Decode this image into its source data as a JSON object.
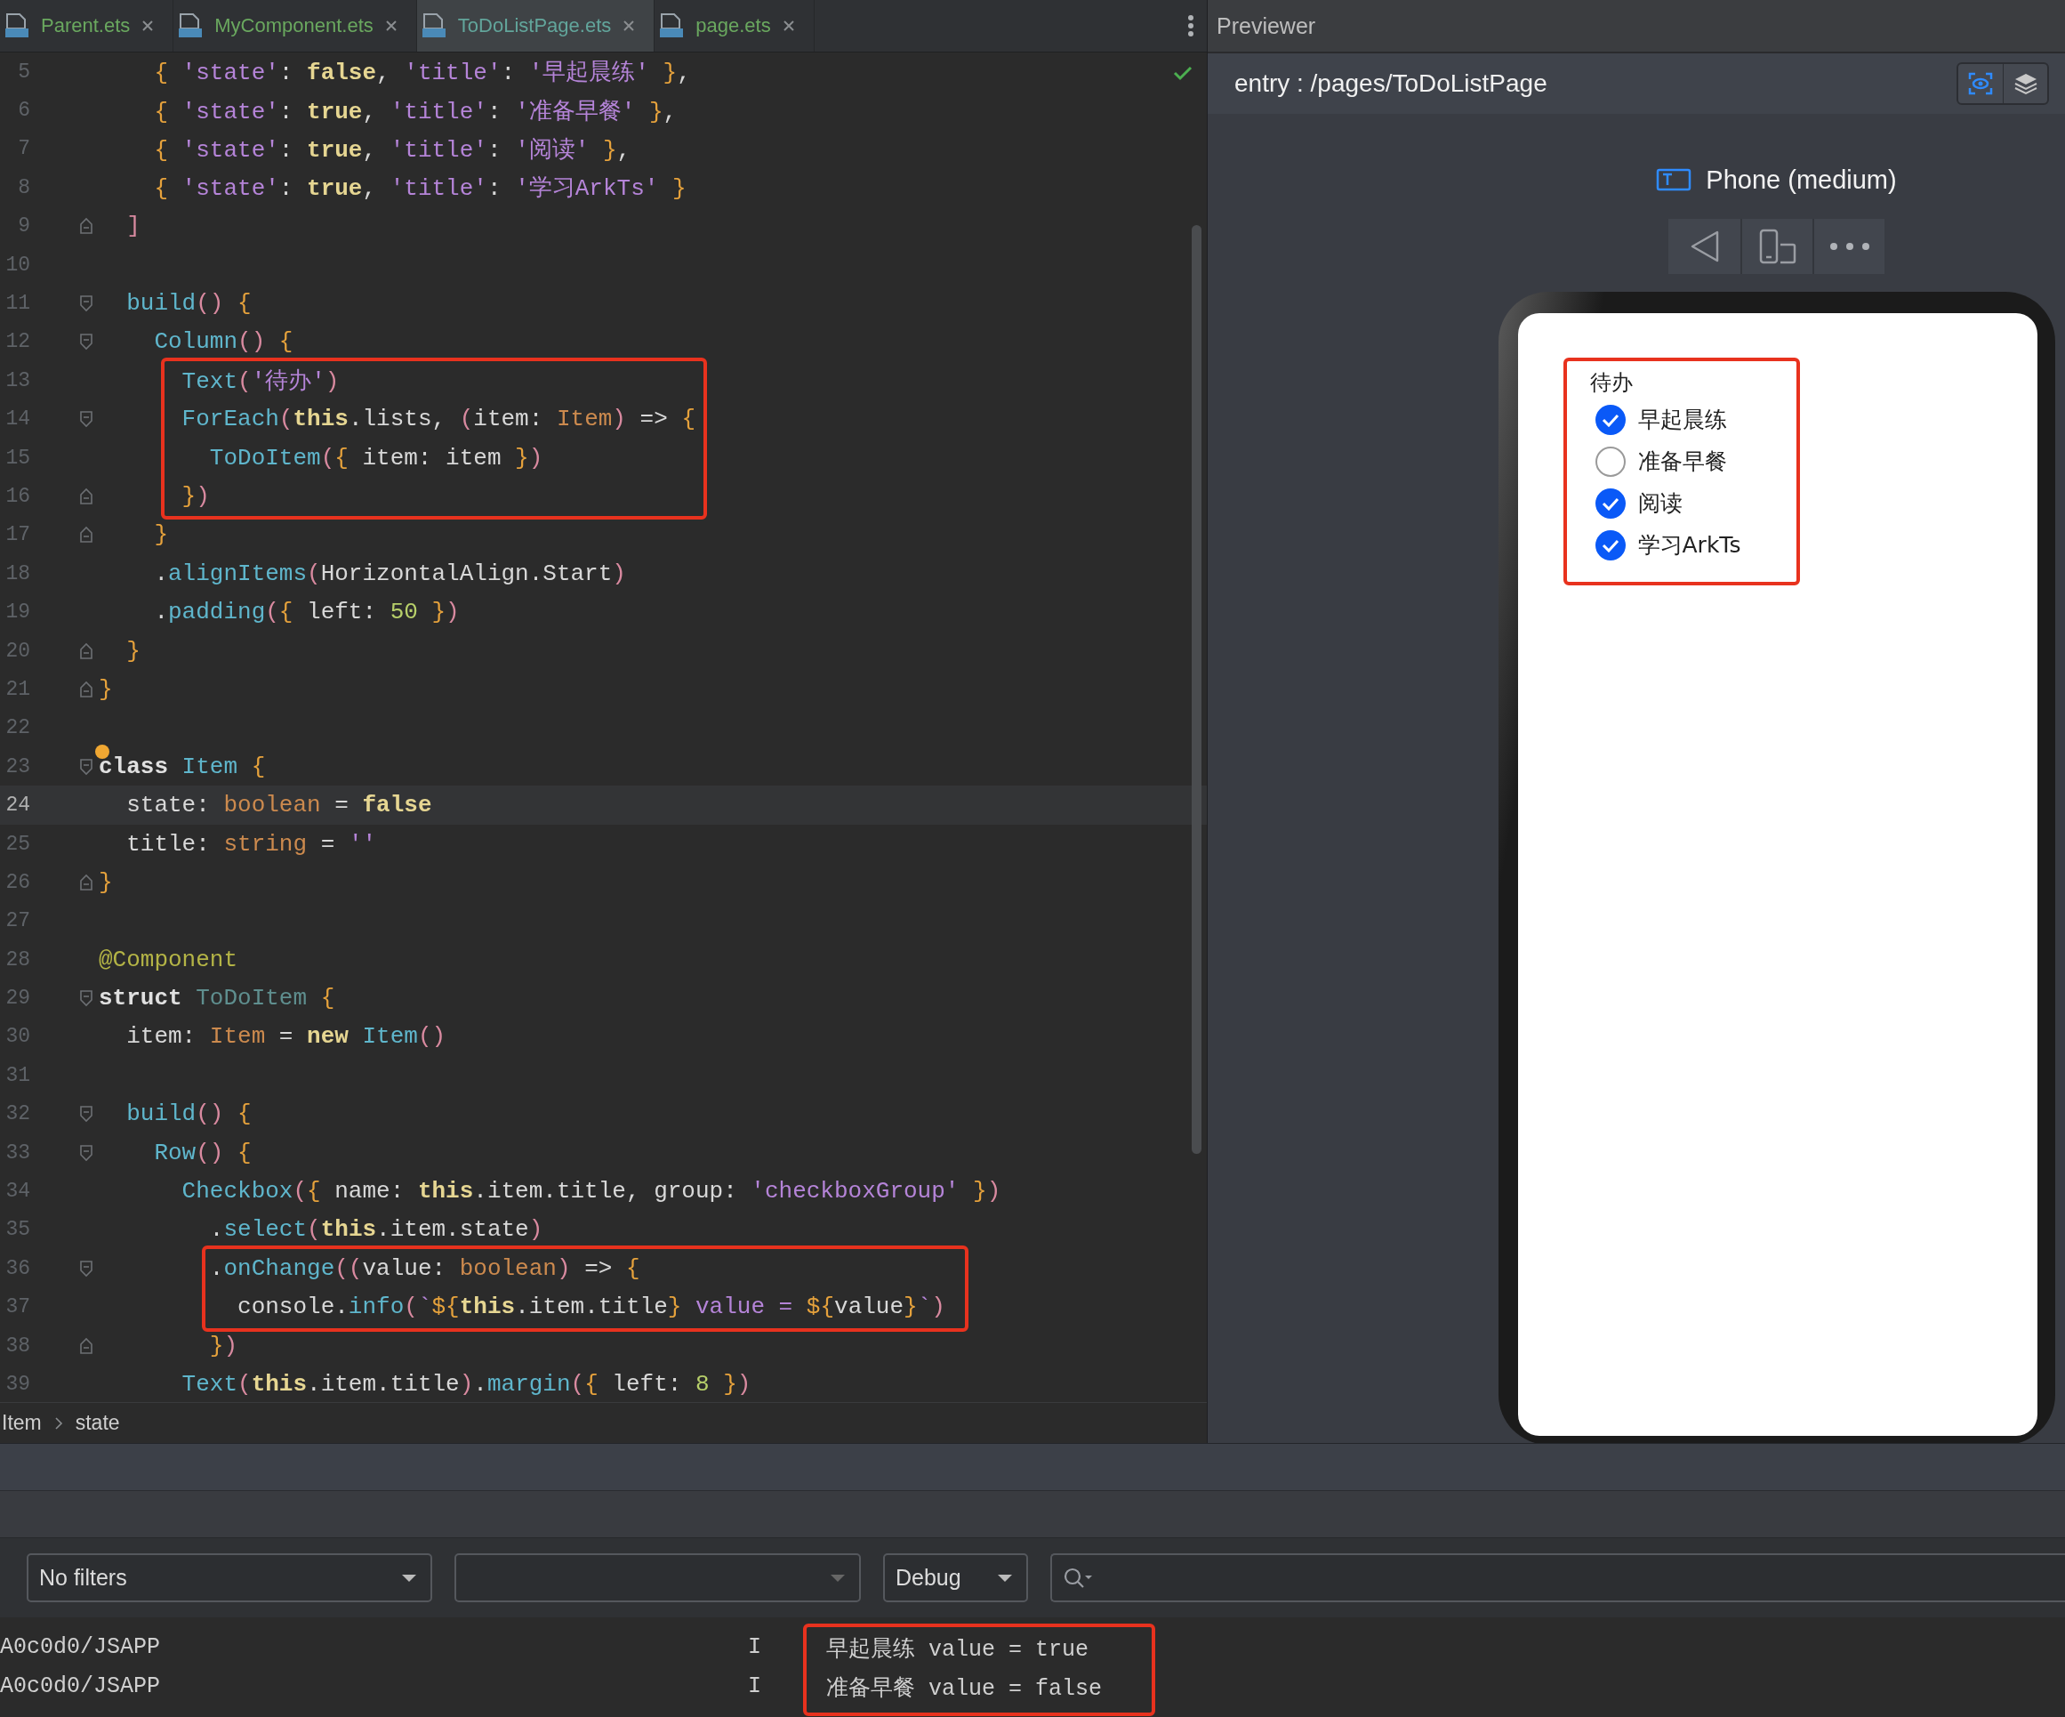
{
  "tabs": [
    {
      "label": "Parent.ets",
      "selected": false
    },
    {
      "label": "MyComponent.ets",
      "selected": false
    },
    {
      "label": "ToDoListPage.ets",
      "selected": true
    },
    {
      "label": "page.ets",
      "selected": false
    }
  ],
  "editor": {
    "lines": [
      {
        "number": "5",
        "tokens": [
          {
            "kind": "brace",
            "text": "    {"
          },
          {
            "kind": "string",
            "text": " 'state'"
          },
          {
            "kind": "plain",
            "text": ": "
          },
          {
            "kind": "keyword",
            "text": "false"
          },
          {
            "kind": "plain",
            "text": ", "
          },
          {
            "kind": "string",
            "text": "'title'"
          },
          {
            "kind": "plain",
            "text": ": "
          },
          {
            "kind": "string",
            "text": "'早起晨练'"
          },
          {
            "kind": "brace",
            "text": " }"
          },
          {
            "kind": "plain",
            "text": ","
          }
        ]
      },
      {
        "number": "6",
        "tokens": [
          {
            "kind": "brace",
            "text": "    {"
          },
          {
            "kind": "string",
            "text": " 'state'"
          },
          {
            "kind": "plain",
            "text": ": "
          },
          {
            "kind": "keyword",
            "text": "true"
          },
          {
            "kind": "plain",
            "text": ", "
          },
          {
            "kind": "string",
            "text": "'title'"
          },
          {
            "kind": "plain",
            "text": ": "
          },
          {
            "kind": "string",
            "text": "'准备早餐'"
          },
          {
            "kind": "brace",
            "text": " }"
          },
          {
            "kind": "plain",
            "text": ","
          }
        ]
      },
      {
        "number": "7",
        "tokens": [
          {
            "kind": "brace",
            "text": "    {"
          },
          {
            "kind": "string",
            "text": " 'state'"
          },
          {
            "kind": "plain",
            "text": ": "
          },
          {
            "kind": "keyword",
            "text": "true"
          },
          {
            "kind": "plain",
            "text": ", "
          },
          {
            "kind": "string",
            "text": "'title'"
          },
          {
            "kind": "plain",
            "text": ": "
          },
          {
            "kind": "string",
            "text": "'阅读'"
          },
          {
            "kind": "brace",
            "text": " }"
          },
          {
            "kind": "plain",
            "text": ","
          }
        ]
      },
      {
        "number": "8",
        "tokens": [
          {
            "kind": "brace",
            "text": "    {"
          },
          {
            "kind": "string",
            "text": " 'state'"
          },
          {
            "kind": "plain",
            "text": ": "
          },
          {
            "kind": "keyword",
            "text": "true"
          },
          {
            "kind": "plain",
            "text": ", "
          },
          {
            "kind": "string",
            "text": "'title'"
          },
          {
            "kind": "plain",
            "text": ": "
          },
          {
            "kind": "string",
            "text": "'学习ArkTs'"
          },
          {
            "kind": "brace",
            "text": " }"
          }
        ]
      },
      {
        "number": "9",
        "fold_close": true,
        "tokens": [
          {
            "kind": "paren",
            "text": "  ]"
          }
        ]
      },
      {
        "number": "10"
      },
      {
        "number": "11",
        "fold_open": true,
        "tokens": [
          {
            "kind": "func",
            "text": "  build"
          },
          {
            "kind": "paren",
            "text": "()"
          },
          {
            "kind": "brace",
            "text": " {"
          }
        ]
      },
      {
        "number": "12",
        "fold_open": true,
        "tokens": [
          {
            "kind": "func",
            "text": "    Column"
          },
          {
            "kind": "paren",
            "text": "()"
          },
          {
            "kind": "brace",
            "text": " {"
          }
        ]
      },
      {
        "number": "13",
        "tokens": [
          {
            "kind": "func",
            "text": "      Text"
          },
          {
            "kind": "paren",
            "text": "("
          },
          {
            "kind": "string",
            "text": "'待办'"
          },
          {
            "kind": "paren",
            "text": ")"
          }
        ]
      },
      {
        "number": "14",
        "fold_open": true,
        "tokens": [
          {
            "kind": "func",
            "text": "      ForEach"
          },
          {
            "kind": "paren",
            "text": "("
          },
          {
            "kind": "keyword",
            "text": "this"
          },
          {
            "kind": "plain",
            "text": ".lists, "
          },
          {
            "kind": "paren",
            "text": "("
          },
          {
            "kind": "plain",
            "text": "item: "
          },
          {
            "kind": "type",
            "text": "Item"
          },
          {
            "kind": "paren",
            "text": ")"
          },
          {
            "kind": "plain",
            "text": " => "
          },
          {
            "kind": "brace",
            "text": "{"
          }
        ]
      },
      {
        "number": "15",
        "tokens": [
          {
            "kind": "func",
            "text": "        ToDoItem"
          },
          {
            "kind": "paren",
            "text": "("
          },
          {
            "kind": "brace",
            "text": "{"
          },
          {
            "kind": "plain",
            "text": " item: item "
          },
          {
            "kind": "brace",
            "text": "}"
          },
          {
            "kind": "paren",
            "text": ")"
          }
        ]
      },
      {
        "number": "16",
        "fold_close": true,
        "tokens": [
          {
            "kind": "brace",
            "text": "      }"
          },
          {
            "kind": "paren",
            "text": ")"
          }
        ]
      },
      {
        "number": "17",
        "fold_close": true,
        "tokens": [
          {
            "kind": "brace",
            "text": "    }"
          }
        ]
      },
      {
        "number": "18",
        "tokens": [
          {
            "kind": "plain",
            "text": "    ."
          },
          {
            "kind": "func",
            "text": "alignItems"
          },
          {
            "kind": "paren",
            "text": "("
          },
          {
            "kind": "plain",
            "text": "HorizontalAlign.Start"
          },
          {
            "kind": "paren",
            "text": ")"
          }
        ]
      },
      {
        "number": "19",
        "tokens": [
          {
            "kind": "plain",
            "text": "    ."
          },
          {
            "kind": "func",
            "text": "padding"
          },
          {
            "kind": "paren",
            "text": "("
          },
          {
            "kind": "brace",
            "text": "{"
          },
          {
            "kind": "plain",
            "text": " left: "
          },
          {
            "kind": "number",
            "text": "50"
          },
          {
            "kind": "brace",
            "text": " }"
          },
          {
            "kind": "paren",
            "text": ")"
          }
        ]
      },
      {
        "number": "20",
        "fold_close": true,
        "tokens": [
          {
            "kind": "brace",
            "text": "  }"
          }
        ]
      },
      {
        "number": "21",
        "fold_close": true,
        "tokens": [
          {
            "kind": "brace",
            "text": "}"
          }
        ]
      },
      {
        "number": "22"
      },
      {
        "number": "23",
        "fold_open": true,
        "bulb": true,
        "tokens": [
          {
            "kind": "declare",
            "text": "class"
          },
          {
            "kind": "func",
            "text": " Item"
          },
          {
            "kind": "brace",
            "text": " {"
          }
        ]
      },
      {
        "number": "24",
        "current": true,
        "tokens": [
          {
            "kind": "plain",
            "text": "  state: "
          },
          {
            "kind": "type",
            "text": "boolean"
          },
          {
            "kind": "plain",
            "text": " = "
          },
          {
            "kind": "keyword",
            "text": "false"
          }
        ]
      },
      {
        "number": "25",
        "tokens": [
          {
            "kind": "plain",
            "text": "  title: "
          },
          {
            "kind": "type",
            "text": "string"
          },
          {
            "kind": "plain",
            "text": " = "
          },
          {
            "kind": "string",
            "text": "''"
          }
        ]
      },
      {
        "number": "26",
        "fold_close": true,
        "tokens": [
          {
            "kind": "brace",
            "text": "}"
          }
        ]
      },
      {
        "number": "27"
      },
      {
        "number": "28",
        "tokens": [
          {
            "kind": "annotation",
            "text": "@Component"
          }
        ]
      },
      {
        "number": "29",
        "fold_open": true,
        "tokens": [
          {
            "kind": "declare",
            "text": "struct"
          },
          {
            "kind": "unused",
            "text": " ToDoItem"
          },
          {
            "kind": "brace",
            "text": " {"
          }
        ]
      },
      {
        "number": "30",
        "tokens": [
          {
            "kind": "plain",
            "text": "  item: "
          },
          {
            "kind": "type",
            "text": "Item"
          },
          {
            "kind": "plain",
            "text": " = "
          },
          {
            "kind": "keyword",
            "text": "new"
          },
          {
            "kind": "func",
            "text": " Item"
          },
          {
            "kind": "paren",
            "text": "()"
          }
        ]
      },
      {
        "number": "31"
      },
      {
        "number": "32",
        "fold_open": true,
        "tokens": [
          {
            "kind": "func",
            "text": "  build"
          },
          {
            "kind": "paren",
            "text": "()"
          },
          {
            "kind": "brace",
            "text": " {"
          }
        ]
      },
      {
        "number": "33",
        "fold_open": true,
        "tokens": [
          {
            "kind": "func",
            "text": "    Row"
          },
          {
            "kind": "paren",
            "text": "()"
          },
          {
            "kind": "brace",
            "text": " {"
          }
        ]
      },
      {
        "number": "34",
        "tokens": [
          {
            "kind": "func",
            "text": "      Checkbox"
          },
          {
            "kind": "paren",
            "text": "("
          },
          {
            "kind": "brace",
            "text": "{"
          },
          {
            "kind": "plain",
            "text": " name: "
          },
          {
            "kind": "keyword",
            "text": "this"
          },
          {
            "kind": "plain",
            "text": ".item.title, group: "
          },
          {
            "kind": "string",
            "text": "'checkboxGroup'"
          },
          {
            "kind": "brace",
            "text": " }"
          },
          {
            "kind": "paren",
            "text": ")"
          }
        ]
      },
      {
        "number": "35",
        "tokens": [
          {
            "kind": "plain",
            "text": "        ."
          },
          {
            "kind": "func",
            "text": "select"
          },
          {
            "kind": "paren",
            "text": "("
          },
          {
            "kind": "keyword",
            "text": "this"
          },
          {
            "kind": "plain",
            "text": ".item.state"
          },
          {
            "kind": "paren",
            "text": ")"
          }
        ]
      },
      {
        "number": "36",
        "fold_open": true,
        "tokens": [
          {
            "kind": "plain",
            "text": "        ."
          },
          {
            "kind": "func",
            "text": "onChange"
          },
          {
            "kind": "paren",
            "text": "(("
          },
          {
            "kind": "plain",
            "text": "value: "
          },
          {
            "kind": "type",
            "text": "boolean"
          },
          {
            "kind": "paren",
            "text": ")"
          },
          {
            "kind": "plain",
            "text": " => "
          },
          {
            "kind": "brace",
            "text": "{"
          }
        ]
      },
      {
        "number": "37",
        "tokens": [
          {
            "kind": "plain",
            "text": "          console."
          },
          {
            "kind": "func",
            "text": "info"
          },
          {
            "kind": "paren",
            "text": "("
          },
          {
            "kind": "string",
            "text": "`"
          },
          {
            "kind": "brace",
            "text": "${"
          },
          {
            "kind": "keyword",
            "text": "this"
          },
          {
            "kind": "plain",
            "text": ".item.title"
          },
          {
            "kind": "brace",
            "text": "}"
          },
          {
            "kind": "string",
            "text": " value = "
          },
          {
            "kind": "brace",
            "text": "${"
          },
          {
            "kind": "plain",
            "text": "value"
          },
          {
            "kind": "brace",
            "text": "}"
          },
          {
            "kind": "string",
            "text": "`"
          },
          {
            "kind": "paren",
            "text": ")"
          }
        ]
      },
      {
        "number": "38",
        "fold_close": true,
        "tokens": [
          {
            "kind": "brace",
            "text": "        }"
          },
          {
            "kind": "paren",
            "text": ")"
          }
        ]
      },
      {
        "number": "39",
        "tokens": [
          {
            "kind": "func",
            "text": "      Text"
          },
          {
            "kind": "paren",
            "text": "("
          },
          {
            "kind": "keyword",
            "text": "this"
          },
          {
            "kind": "plain",
            "text": ".item.title"
          },
          {
            "kind": "paren",
            "text": ")"
          },
          {
            "kind": "plain",
            "text": "."
          },
          {
            "kind": "func",
            "text": "margin"
          },
          {
            "kind": "paren",
            "text": "("
          },
          {
            "kind": "brace",
            "text": "{"
          },
          {
            "kind": "plain",
            "text": " left: "
          },
          {
            "kind": "number",
            "text": "8"
          },
          {
            "kind": "brace",
            "text": " }"
          },
          {
            "kind": "paren",
            "text": ")"
          }
        ]
      }
    ]
  },
  "breadcrumb": [
    "Item",
    "state"
  ],
  "previewer": {
    "title": "Previewer",
    "route": "entry : /pages/ToDoListPage",
    "device": "Phone (medium)",
    "phone": {
      "heading": "待办",
      "items": [
        {
          "title": "早起晨练",
          "checked": true
        },
        {
          "title": "准备早餐",
          "checked": false
        },
        {
          "title": "阅读",
          "checked": true
        },
        {
          "title": "学习ArkTs",
          "checked": true
        }
      ]
    }
  },
  "log": {
    "filter": "No filters",
    "log_level": "Debug",
    "rows": [
      {
        "tag": "A0c0d0/JSAPP",
        "severity": "I",
        "message": "早起晨练 value = true"
      },
      {
        "tag": "A0c0d0/JSAPP",
        "severity": "I",
        "message": "准备早餐 value = false"
      }
    ]
  }
}
